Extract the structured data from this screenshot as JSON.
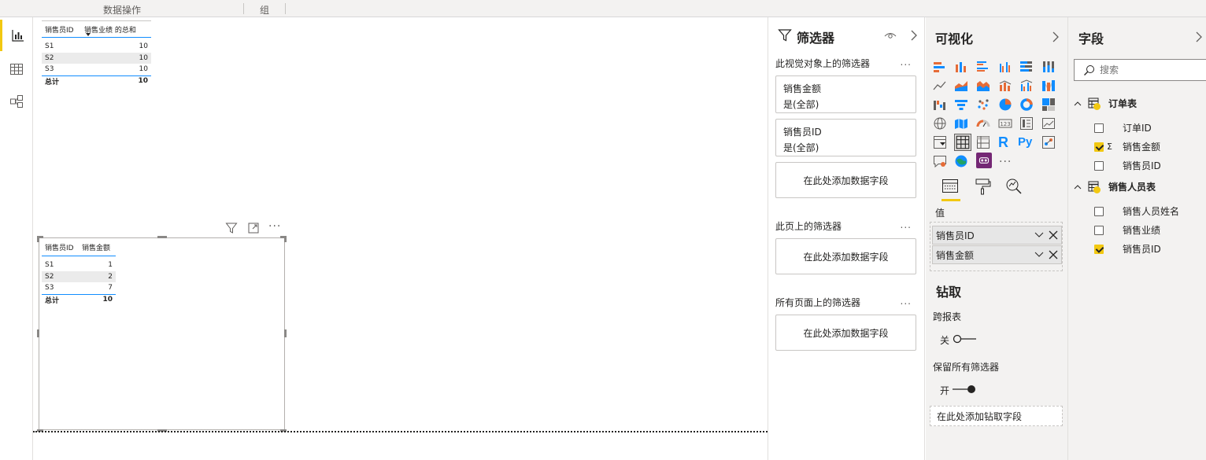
{
  "ribbon": {
    "group1": "数据操作",
    "group2": "组"
  },
  "visual1": {
    "headers": [
      "销售员ID",
      "销售业绩 的总和"
    ],
    "rows": [
      [
        "S1",
        "10"
      ],
      [
        "S2",
        "10"
      ],
      [
        "S3",
        "10"
      ]
    ],
    "total": [
      "总计",
      "10"
    ]
  },
  "visual2": {
    "headers": [
      "销售员ID",
      "销售金额"
    ],
    "rows": [
      [
        "S1",
        "1"
      ],
      [
        "S2",
        "2"
      ],
      [
        "S3",
        "7"
      ]
    ],
    "total": [
      "总计",
      "10"
    ]
  },
  "filters": {
    "title": "筛选器",
    "visual_section": "此视觉对象上的筛选器",
    "cards": [
      {
        "field": "销售金额",
        "state": "是(全部)"
      },
      {
        "field": "销售员ID",
        "state": "是(全部)"
      }
    ],
    "add_field": "在此处添加数据字段",
    "page_section": "此页上的筛选器",
    "all_pages_section": "所有页面上的筛选器",
    "more": "..."
  },
  "viz": {
    "title": "可视化",
    "values_label": "值",
    "wells": [
      "销售员ID",
      "销售金额"
    ],
    "drill": {
      "title": "钻取",
      "cross_report": "跨报表",
      "cross_report_state": "关",
      "keep_filters": "保留所有筛选器",
      "keep_filters_state": "开",
      "add_drill_field": "在此处添加钻取字段"
    },
    "icon_r": "R",
    "icon_py": "Py",
    "more_visuals": "..."
  },
  "fields": {
    "title": "字段",
    "search_placeholder": "搜索",
    "tables": [
      {
        "name": "订单表",
        "fields": [
          {
            "name": "订单ID",
            "checked": false,
            "sigma": false
          },
          {
            "name": "销售金额",
            "checked": true,
            "sigma": true
          },
          {
            "name": "销售员ID",
            "checked": false,
            "sigma": false
          }
        ]
      },
      {
        "name": "销售人员表",
        "fields": [
          {
            "name": "销售人员姓名",
            "checked": false,
            "sigma": false
          },
          {
            "name": "销售业绩",
            "checked": false,
            "sigma": false
          },
          {
            "name": "销售员ID",
            "checked": true,
            "sigma": false
          }
        ]
      }
    ],
    "sigma_symbol": "Σ"
  },
  "colors": {
    "accent": "#f2c811",
    "table_line": "#118dff",
    "well_bg": "#e6e6e6",
    "pane_bg": "#f3f2f1"
  }
}
